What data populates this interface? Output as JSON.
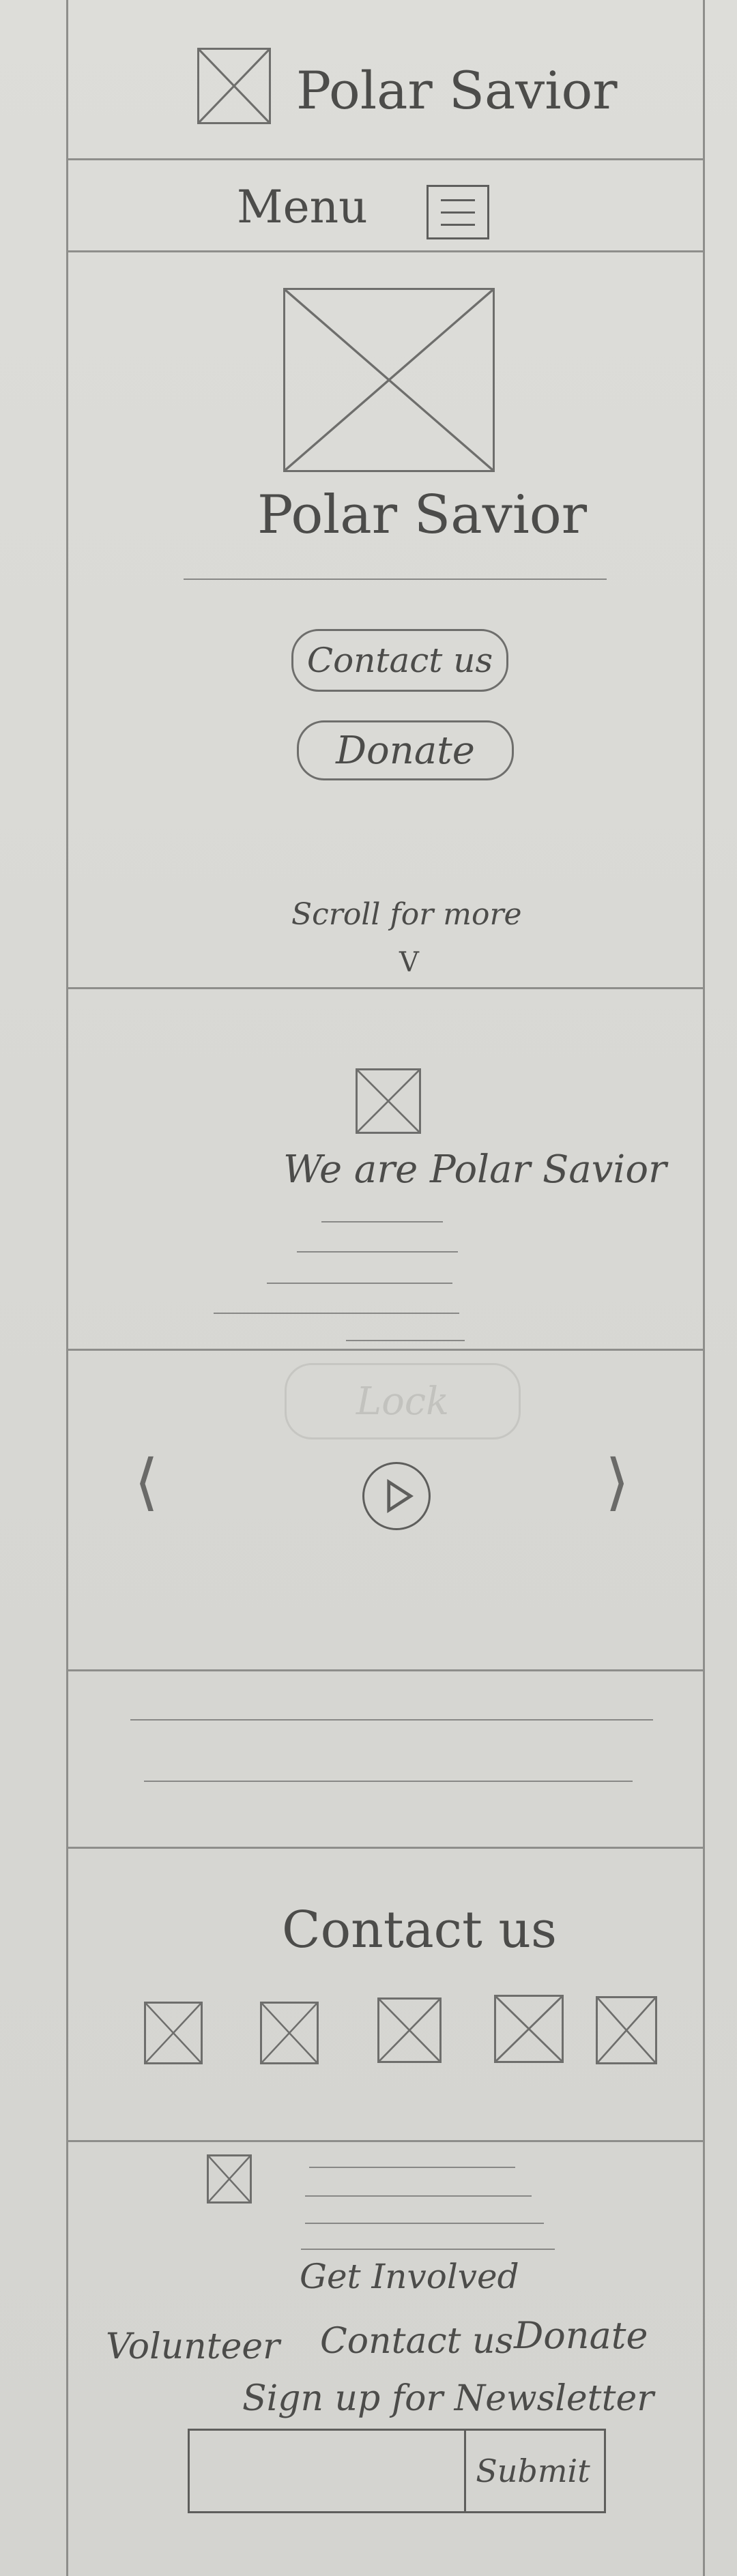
{
  "header": {
    "brand": "Polar Savior"
  },
  "menu": {
    "label": "Menu",
    "icon": "hamburger-icon"
  },
  "hero": {
    "title": "Polar Savior",
    "contact_button": "Contact us",
    "donate_button": "Donate",
    "scroll_hint": "Scroll for more",
    "scroll_arrow": "V"
  },
  "about": {
    "heading": "We are Polar Savior"
  },
  "carousel": {
    "faded_button": "Lock",
    "prev_icon": "chevron-left-icon",
    "next_icon": "chevron-right-icon",
    "play_icon": "play-icon"
  },
  "contact": {
    "heading": "Contact us"
  },
  "footer": {
    "get_involved": "Get Involved",
    "links": [
      "Volunteer",
      "Contact us",
      "Donate"
    ],
    "newsletter_label": "Sign up for Newsletter",
    "submit_label": "Submit"
  }
}
